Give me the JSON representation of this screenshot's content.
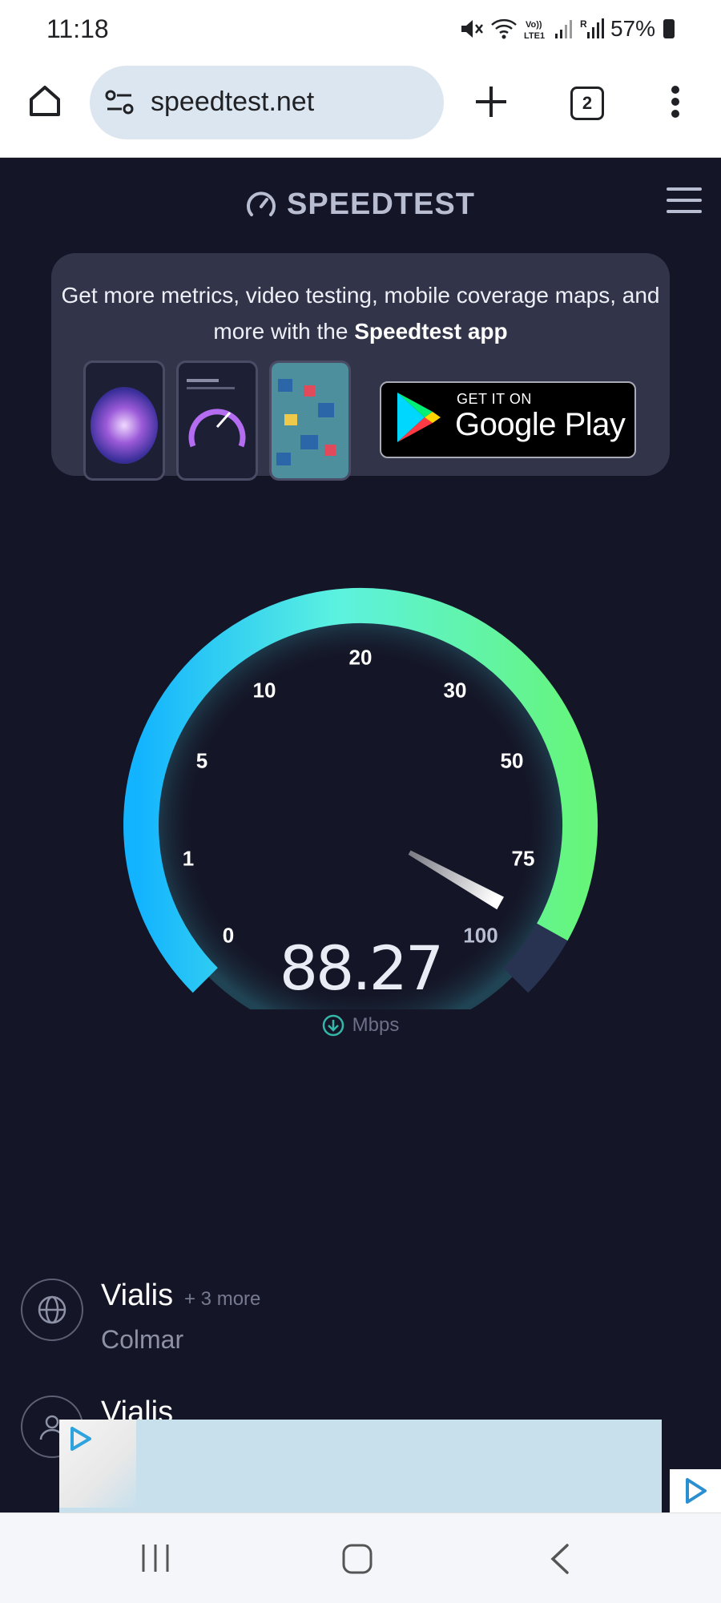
{
  "status_bar": {
    "time": "11:18",
    "battery": "57%"
  },
  "browser": {
    "url": "speedtest.net",
    "tab_count": "2"
  },
  "site": {
    "logo": "SPEEDTEST",
    "promo": {
      "text_part1": "Get more metrics, video testing, mobile coverage maps, and more with the ",
      "text_bold": "Speedtest app"
    },
    "google_play": {
      "small": "GET IT ON",
      "big": "Google Play"
    },
    "gauge": {
      "ticks": [
        "0",
        "1",
        "5",
        "10",
        "20",
        "30",
        "50",
        "75",
        "100"
      ],
      "value": "88.27",
      "unit": "Mbps",
      "colors": {
        "low": "#12b3ff",
        "mid": "#5cf2e0",
        "high": "#66f57a",
        "track": "#283352"
      }
    },
    "isp": {
      "name": "Vialis",
      "more": "+ 3 more",
      "location": "Colmar"
    },
    "host": {
      "name": "Vialis"
    }
  }
}
